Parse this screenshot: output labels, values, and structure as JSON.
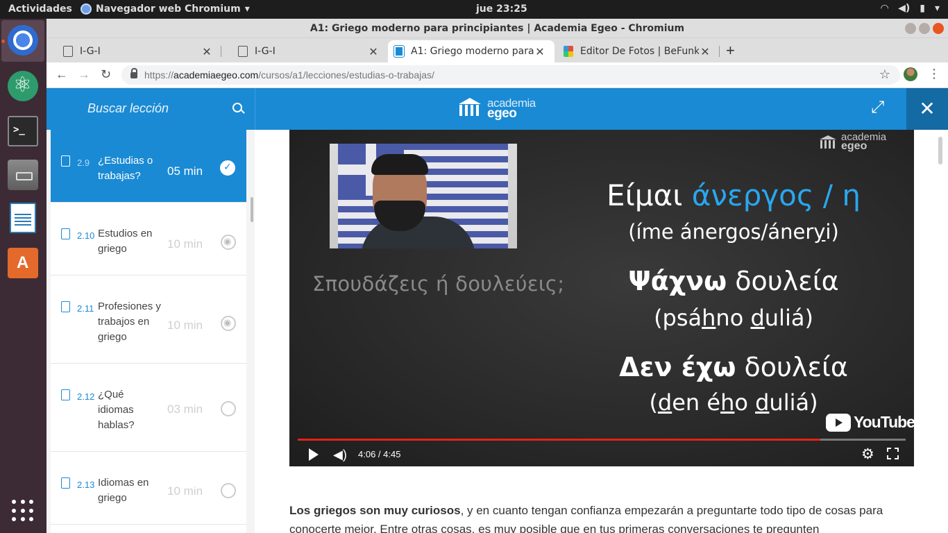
{
  "topbar": {
    "activities": "Actividades",
    "app_menu": "Navegador web Chromium",
    "clock": "jue 23:25",
    "tray_icons": [
      "wifi-icon",
      "volume-icon",
      "battery-icon",
      "chevron-down-icon"
    ]
  },
  "dock": {
    "items": [
      "chromium-icon",
      "atom-icon",
      "terminal-icon",
      "files-icon",
      "writer-icon",
      "software-center-icon",
      "show-apps-icon"
    ]
  },
  "window": {
    "title": "A1: Griego moderno para principiantes | Academia Egeo - Chromium"
  },
  "tabs": [
    {
      "label": "I-G-I",
      "active": false
    },
    {
      "label": "I-G-I",
      "active": false
    },
    {
      "label": "A1: Griego moderno para principiantes | Academia Egeo",
      "active": true
    },
    {
      "label": "Editor De Fotos | BeFunky",
      "active": false
    }
  ],
  "address": {
    "scheme": "https://",
    "host": "academiaegeo.com",
    "path": "/cursos/a1/lecciones/estudias-o-trabajas/"
  },
  "header": {
    "search_label": "Buscar lección",
    "logo_line1": "academia",
    "logo_line2": "egeo",
    "close_symbol": "✕"
  },
  "lessons": [
    {
      "num": "2.9",
      "title": "¿Estudias o trabajas?",
      "duration": "05 min",
      "status": "completed",
      "active": true
    },
    {
      "num": "2.10",
      "title": "Estudios en griego",
      "duration": "10 min",
      "status": "viewed",
      "active": false
    },
    {
      "num": "2.11",
      "title": "Profesiones y trabajos en griego",
      "duration": "10 min",
      "status": "viewed",
      "active": false
    },
    {
      "num": "2.12",
      "title": "¿Qué idiomas hablas?",
      "duration": "03 min",
      "status": "pending",
      "active": false
    },
    {
      "num": "2.13",
      "title": "Idiomas en griego",
      "duration": "10 min",
      "status": "pending",
      "active": false
    }
  ],
  "video": {
    "watermark_line1": "academia",
    "watermark_line2": "egeo",
    "question": "Σπουδάζεις ή δουλεύεις;",
    "line1_a": "Είμαι ",
    "line1_b": "άνεργος / η",
    "translit1_a": "(íme ánergos/áner",
    "translit1_u": "y",
    "translit1_b": "i)",
    "line2_a": "Ψάχνω",
    "line2_b": " δουλεία",
    "translit2_a": "(psá",
    "translit2_u1": "h",
    "translit2_b": "no ",
    "translit2_u2": "d",
    "translit2_c": "uliá)",
    "line3": "Δεν έχω",
    "line3_b": " δουλεία",
    "translit3_a": "(",
    "translit3_u1": "d",
    "translit3_b": "en é",
    "translit3_u2": "h",
    "translit3_c": "o ",
    "translit3_u3": "d",
    "translit3_d": "uliá)",
    "youtube_label": "YouTube",
    "time": "4:06 / 4:45",
    "progress_fraction": 0.86
  },
  "article": {
    "bold": "Los griegos son muy curiosos",
    "text1": ", y en cuanto tengan confianza empezarán a preguntarte todo tipo de cosas para conocerte mejor. Entre otras cosas, es muy posible que en tus primeras conversaciones te pregunten"
  },
  "colors": {
    "brand_blue": "#1a8ad4",
    "brand_dark": "#146aa3",
    "ubuntu_orange": "#e95420",
    "youtube_red": "#e62117"
  }
}
